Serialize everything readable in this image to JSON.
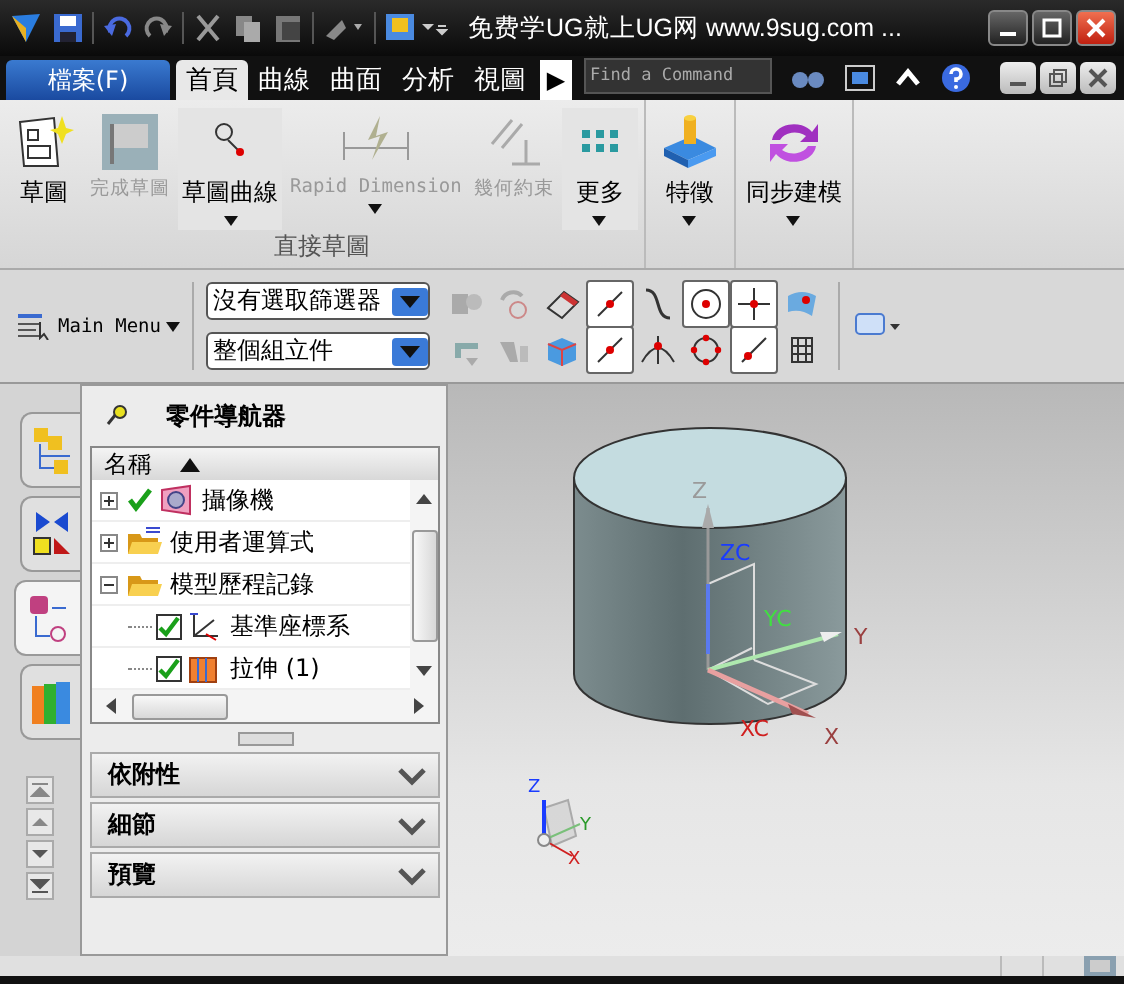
{
  "window": {
    "title": "免费学UG就上UG网 www.9sug.com ..."
  },
  "file_tab": {
    "label": "檔案(F)"
  },
  "tabs": [
    {
      "label": "首頁",
      "selected": true
    },
    {
      "label": "曲線",
      "selected": false
    },
    {
      "label": "曲面",
      "selected": false
    },
    {
      "label": "分析",
      "selected": false
    },
    {
      "label": "視圖",
      "selected": false
    }
  ],
  "more_tabs": "▶",
  "search": {
    "placeholder": "Find a Command"
  },
  "ribbon": {
    "buttons": [
      {
        "label": "草圖",
        "disabled": false,
        "dropdown": false,
        "kind": "sketch"
      },
      {
        "label": "完成草圖",
        "disabled": true,
        "dropdown": false,
        "kind": "finish"
      },
      {
        "label": "草圖曲線",
        "disabled": false,
        "dropdown": true,
        "kind": "curve"
      },
      {
        "label": "Rapid Dimension",
        "disabled": true,
        "dropdown": true,
        "kind": "dimension"
      },
      {
        "label": "幾何約束",
        "disabled": true,
        "dropdown": false,
        "kind": "constraint"
      },
      {
        "label": "更多",
        "disabled": false,
        "dropdown": true,
        "kind": "more"
      },
      {
        "label": "特徵",
        "disabled": false,
        "dropdown": true,
        "kind": "feature"
      },
      {
        "label": "同步建模",
        "disabled": false,
        "dropdown": true,
        "kind": "sync"
      }
    ],
    "group_label": "直接草圖"
  },
  "toolbar": {
    "main_menu": "Main Menu",
    "filters": [
      "沒有選取篩選器",
      "整個組立件"
    ]
  },
  "navigator": {
    "title": "零件導航器",
    "column": "名稱",
    "tree": [
      {
        "label": "攝像機",
        "expanded": false,
        "checked": true,
        "kind": "camera"
      },
      {
        "label": "使用者運算式",
        "expanded": false,
        "checked": false,
        "kind": "folder"
      },
      {
        "label": "模型歷程記錄",
        "expanded": true,
        "checked": false,
        "kind": "folder",
        "children": [
          {
            "label": "基準座標系",
            "checked": true,
            "kind": "datum"
          },
          {
            "label": "拉伸 (1)",
            "checked": true,
            "kind": "extrude"
          }
        ]
      }
    ],
    "panels": [
      {
        "label": "依附性",
        "expanded": false
      },
      {
        "label": "細節",
        "expanded": false
      },
      {
        "label": "預覽",
        "expanded": false
      }
    ]
  },
  "viewport": {
    "labels": [
      {
        "text": "Z",
        "color": "#9a9a9a"
      },
      {
        "text": "ZC",
        "color": "#1a3cff"
      },
      {
        "text": "YC",
        "color": "#40e040"
      },
      {
        "text": "Y",
        "color": "#9a4040"
      },
      {
        "text": "XC",
        "color": "#d02020"
      },
      {
        "text": "X",
        "color": "#9a4040"
      }
    ],
    "triad_labels": [
      {
        "text": "Z",
        "color": "#1a3cff"
      },
      {
        "text": "Y",
        "color": "#2a9a2a"
      },
      {
        "text": "X",
        "color": "#d02020"
      }
    ]
  }
}
